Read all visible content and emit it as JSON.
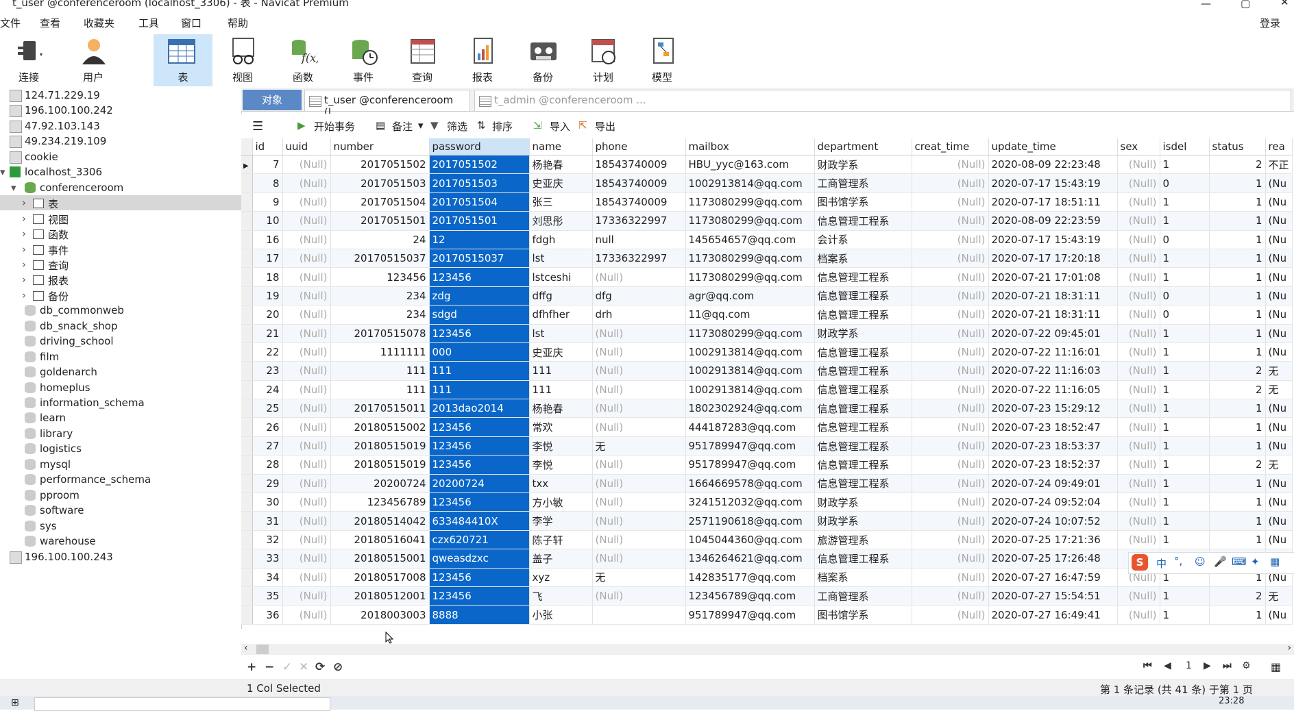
{
  "window_title": "t_user @conferenceroom (localhost_3306) - 表 - Navicat Premium",
  "menu": {
    "file": "文件",
    "view": "查看",
    "favorites": "收藏夹",
    "tools": "工具",
    "window": "窗口",
    "help": "帮助",
    "login": "登录"
  },
  "toolbar": {
    "connect": "连接",
    "user": "用户",
    "table": "表",
    "view": "视图",
    "function": "函数",
    "event": "事件",
    "query": "查询",
    "report": "报表",
    "backup": "备份",
    "schedule": "计划",
    "model": "模型"
  },
  "sidebar": {
    "conn1": "124.71.229.19",
    "conn2": "196.100.100.242",
    "conn3": "47.92.103.143",
    "conn4": "49.234.219.109",
    "conn5": "cookie",
    "conn6": "localhost_3306",
    "db_active": "conferenceroom",
    "n_table": "表",
    "n_view": "视图",
    "n_function": "函数",
    "n_event": "事件",
    "n_query": "查询",
    "n_report": "报表",
    "n_backup": "备份",
    "db1": "db_commonweb",
    "db2": "db_snack_shop",
    "db3": "driving_school",
    "db4": "film",
    "db5": "goldenarch",
    "db6": "homeplus",
    "db7": "information_schema",
    "db8": "learn",
    "db9": "library",
    "db10": "logistics",
    "db11": "mysql",
    "db12": "performance_schema",
    "db13": "pproom",
    "db14": "software",
    "db15": "sys",
    "db16": "warehouse",
    "conn7": "196.100.100.243"
  },
  "tabs": {
    "objects": "对象",
    "tab1": "t_user @conferenceroom (l...",
    "tab2": "t_admin @conferenceroom ..."
  },
  "gridtoolbar": {
    "begin_tx": "开始事务",
    "note": "备注",
    "filter": "筛选",
    "sort": "排序",
    "import": "导入",
    "export": "导出"
  },
  "columns": [
    "id",
    "uuid",
    "number",
    "password",
    "name",
    "phone",
    "mailbox",
    "department",
    "creat_time",
    "update_time",
    "sex",
    "isdel",
    "status",
    "rea"
  ],
  "rows": [
    [
      "7",
      "(Null)",
      "2017051502",
      "2017051502",
      "杨艳春",
      "18543740009",
      "HBU_yyc@163.com",
      "财政学系",
      "(Null)",
      "2020-08-09 22:23:48",
      "(Null)",
      "1",
      "2",
      "不正"
    ],
    [
      "8",
      "(Null)",
      "2017051503",
      "2017051503",
      "史亚庆",
      "18543740009",
      "1002913814@qq.com",
      "工商管理系",
      "(Null)",
      "2020-07-17 15:43:19",
      "(Null)",
      "0",
      "1",
      "(Nu"
    ],
    [
      "9",
      "(Null)",
      "2017051504",
      "2017051504",
      "张三",
      "18543740009",
      "1173080299@qq.com",
      "图书馆学系",
      "(Null)",
      "2020-07-17 18:51:11",
      "(Null)",
      "1",
      "1",
      "(Nu"
    ],
    [
      "10",
      "(Null)",
      "2017051501",
      "2017051501",
      "刘思彤",
      "17336322997",
      "1173080299@qq.com",
      "信息管理工程系",
      "(Null)",
      "2020-08-09 22:23:59",
      "(Null)",
      "1",
      "1",
      "(Nu"
    ],
    [
      "16",
      "(Null)",
      "24",
      "12",
      "fdgh",
      "null",
      "145654657@qq.com",
      "会计系",
      "(Null)",
      "2020-07-17 15:43:19",
      "(Null)",
      "0",
      "1",
      "(Nu"
    ],
    [
      "17",
      "(Null)",
      "20170515037",
      "20170515037",
      "lst",
      "17336322997",
      "1173080299@qq.com",
      "档案系",
      "(Null)",
      "2020-07-17 17:20:18",
      "(Null)",
      "1",
      "1",
      "(Nu"
    ],
    [
      "18",
      "(Null)",
      "123456",
      "123456",
      "lstceshi",
      "(Null)",
      "1173080299@qq.com",
      "信息管理工程系",
      "(Null)",
      "2020-07-21 17:01:08",
      "(Null)",
      "1",
      "1",
      "(Nu"
    ],
    [
      "19",
      "(Null)",
      "234",
      "zdg",
      "dffg",
      "dfg",
      "agr@qq.com",
      "信息管理工程系",
      "(Null)",
      "2020-07-21 18:31:11",
      "(Null)",
      "0",
      "1",
      "(Nu"
    ],
    [
      "20",
      "(Null)",
      "234",
      "sdgd",
      "dfhfher",
      "drh",
      "11@qq.com",
      "信息管理工程系",
      "(Null)",
      "2020-07-21 18:31:11",
      "(Null)",
      "0",
      "1",
      "(Nu"
    ],
    [
      "21",
      "(Null)",
      "20170515078",
      "123456",
      "lst",
      "(Null)",
      "1173080299@qq.com",
      "财政学系",
      "(Null)",
      "2020-07-22 09:45:01",
      "(Null)",
      "1",
      "1",
      "(Nu"
    ],
    [
      "22",
      "(Null)",
      "1111111",
      "000",
      "史亚庆",
      "(Null)",
      "1002913814@qq.com",
      "信息管理工程系",
      "(Null)",
      "2020-07-22 11:16:01",
      "(Null)",
      "1",
      "1",
      "(Nu"
    ],
    [
      "23",
      "(Null)",
      "111",
      "111",
      "111",
      "(Null)",
      "1002913814@qq.com",
      "信息管理工程系",
      "(Null)",
      "2020-07-22 11:16:03",
      "(Null)",
      "1",
      "2",
      "无"
    ],
    [
      "24",
      "(Null)",
      "111",
      "111",
      "111",
      "(Null)",
      "1002913814@qq.com",
      "信息管理工程系",
      "(Null)",
      "2020-07-22 11:16:05",
      "(Null)",
      "1",
      "2",
      "无"
    ],
    [
      "25",
      "(Null)",
      "20170515011",
      "2013dao2014",
      "杨艳春",
      "(Null)",
      "1802302924@qq.com",
      "信息管理工程系",
      "(Null)",
      "2020-07-23 15:29:12",
      "(Null)",
      "1",
      "1",
      "(Nu"
    ],
    [
      "26",
      "(Null)",
      "20180515002",
      "123456",
      "常欢",
      "(Null)",
      "444187283@qq.com",
      "信息管理工程系",
      "(Null)",
      "2020-07-23 18:52:47",
      "(Null)",
      "1",
      "1",
      "(Nu"
    ],
    [
      "27",
      "(Null)",
      "20180515019",
      "123456",
      "李悦",
      "无",
      "951789947@qq.com",
      "信息管理工程系",
      "(Null)",
      "2020-07-23 18:53:37",
      "(Null)",
      "1",
      "1",
      "(Nu"
    ],
    [
      "28",
      "(Null)",
      "20180515019",
      "123456",
      "李悦",
      "(Null)",
      "951789947@qq.com",
      "信息管理工程系",
      "(Null)",
      "2020-07-23 18:52:37",
      "(Null)",
      "1",
      "2",
      "无"
    ],
    [
      "29",
      "(Null)",
      "20200724",
      "20200724",
      "txx",
      "(Null)",
      "1664669578@qq.com",
      "信息管理工程系",
      "(Null)",
      "2020-07-24 09:49:01",
      "(Null)",
      "1",
      "1",
      "(Nu"
    ],
    [
      "30",
      "(Null)",
      "123456789",
      "123456",
      "方小敏",
      "(Null)",
      "3241512032@qq.com",
      "财政学系",
      "(Null)",
      "2020-07-24 09:52:04",
      "(Null)",
      "1",
      "1",
      "(Nu"
    ],
    [
      "31",
      "(Null)",
      "20180514042",
      "633484410X",
      "李学",
      "(Null)",
      "2571190618@qq.com",
      "财政学系",
      "(Null)",
      "2020-07-24 10:07:52",
      "(Null)",
      "1",
      "1",
      "(Nu"
    ],
    [
      "32",
      "(Null)",
      "20180516041",
      "czx620721",
      "陈子轩",
      "(Null)",
      "1045044360@qq.com",
      "旅游管理系",
      "(Null)",
      "2020-07-25 17:21:36",
      "(Null)",
      "1",
      "1",
      "(Nu"
    ],
    [
      "33",
      "(Null)",
      "20180515001",
      "qweasdzxc",
      "盖子",
      "(Null)",
      "1346264621@qq.com",
      "信息管理工程系",
      "(Null)",
      "2020-07-25 17:26:48",
      "(Null)",
      "1",
      "1",
      "(Nu"
    ],
    [
      "34",
      "(Null)",
      "20180517008",
      "123456",
      "xyz",
      "无",
      "142835177@qq.com",
      "档案系",
      "(Null)",
      "2020-07-27 16:47:59",
      "(Null)",
      "1",
      "1",
      "(Nu"
    ],
    [
      "35",
      "(Null)",
      "20180512001",
      "123456",
      "飞",
      "(Null)",
      "123456789@qq.com",
      "工商管理系",
      "(Null)",
      "2020-07-27 15:54:51",
      "(Null)",
      "1",
      "2",
      "无"
    ],
    [
      "36",
      "(Null)",
      "2018003003",
      "8888",
      "小张",
      "",
      "951789947@qq.com",
      "图书馆学系",
      "(Null)",
      "2020-07-27 16:49:41",
      "(Null)",
      "1",
      "1",
      "(Nu"
    ]
  ],
  "nav": {
    "page": "1"
  },
  "status": {
    "left": "1 Col Selected",
    "right": "第 1 条记录 (共 41 条) 于第 1 页"
  },
  "taskbar": {
    "time": "23:28"
  },
  "ime": {
    "zh": "中"
  }
}
